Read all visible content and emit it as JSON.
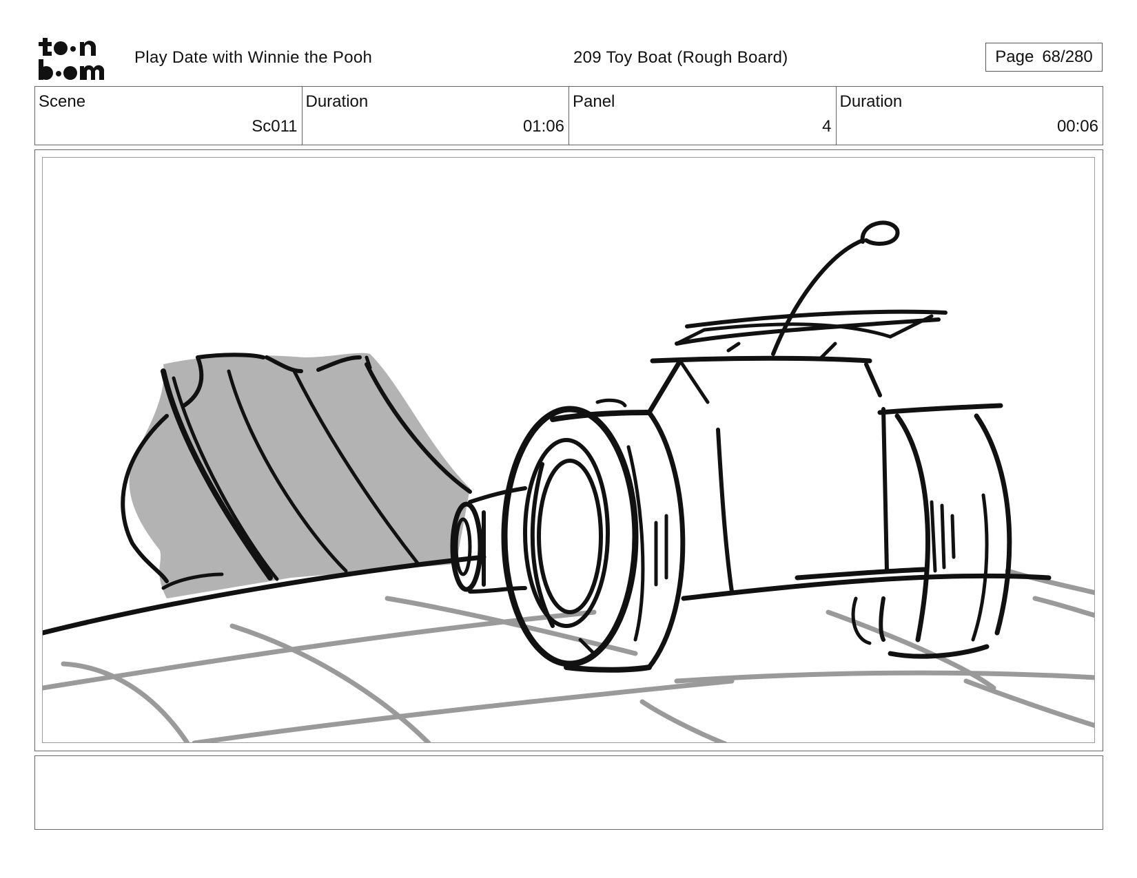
{
  "header": {
    "logo_text": "toon boom",
    "show_title": "Play Date with Winnie the Pooh",
    "episode_title": "209 Toy Boat (Rough Board)",
    "page_label": "Page",
    "page_value": "68/280"
  },
  "info": {
    "scene_label": "Scene",
    "scene_value": "Sc011",
    "scene_duration_label": "Duration",
    "scene_duration_value": "01:06",
    "panel_label": "Panel",
    "panel_value": "4",
    "panel_duration_label": "Duration",
    "panel_duration_value": "00:06"
  },
  "notes": {
    "text": ""
  },
  "colors": {
    "ink": "#111111",
    "shadow_fill": "#b3b3b3",
    "floor_lines": "#9a9a9a",
    "frame_border": "#666666"
  }
}
